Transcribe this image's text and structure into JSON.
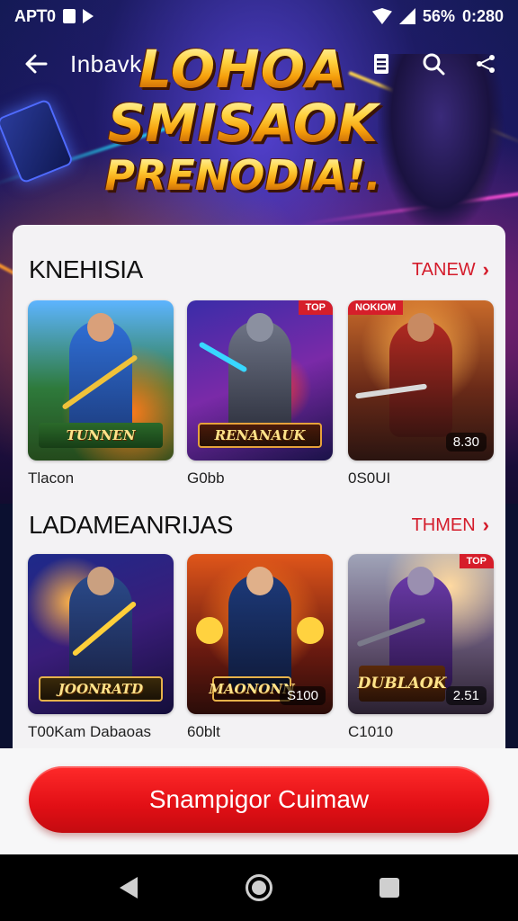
{
  "status_bar": {
    "left_text": "APꓔ0",
    "battery": "56%",
    "time": "0:280"
  },
  "app_bar": {
    "title": "Inbavk",
    "icons": [
      "back-arrow-icon",
      "bookmark-icon",
      "search-icon",
      "share-icon"
    ]
  },
  "banner": {
    "line1": "LOHOA",
    "line2": "SMISAOK",
    "line3": "PRENODIA!."
  },
  "sections": [
    {
      "title": "KNEHISIA",
      "see_all": "TANEW",
      "games": [
        {
          "label": "Tlacon",
          "plate": "TUNNEN",
          "badge": "",
          "rating": ""
        },
        {
          "label": "G0bb",
          "plate": "RENANAUK",
          "badge": "TOP",
          "rating": ""
        },
        {
          "label": "0S0UI",
          "plate": "",
          "badge": "NOKIOM",
          "rating": "8.30"
        }
      ]
    },
    {
      "title": "LADAMEANRIJAS",
      "see_all": "THMEN",
      "games": [
        {
          "label": "T00Kam Dabaoas",
          "plate": "JOONRATD",
          "badge": "",
          "rating": ""
        },
        {
          "label": "60blt",
          "plate": "MAONONN",
          "badge": "",
          "rating": "S100"
        },
        {
          "label": "C1010",
          "plate": "DUBLAOK",
          "badge": "TOP",
          "rating": "2.51"
        }
      ]
    }
  ],
  "cta": {
    "label": "Snampigor Cuimaw"
  },
  "colors": {
    "accent_red": "#d41c2b",
    "cta_red": "#e10f15",
    "banner_gold": "#ffd23f"
  }
}
